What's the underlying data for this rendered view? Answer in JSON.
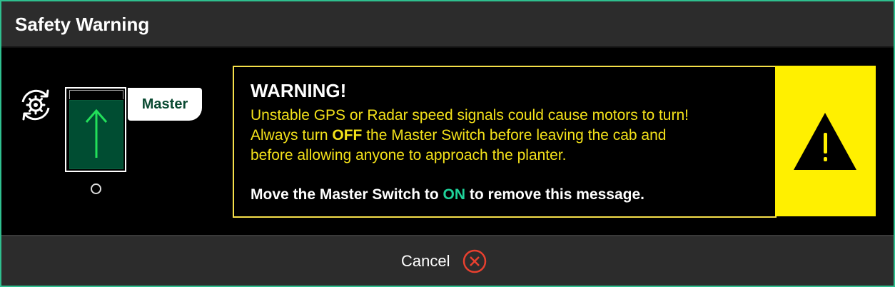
{
  "dialog": {
    "title": "Safety Warning"
  },
  "switch": {
    "label": "Master"
  },
  "warning": {
    "heading": "WARNING!",
    "line1": "Unstable GPS or Radar speed signals could cause motors to turn!",
    "line2_pre": "Always turn ",
    "line2_bold": "OFF",
    "line2_post": " the Master Switch before leaving the cab and",
    "line3": "before allowing anyone to approach the planter.",
    "remove_pre": "Move the Master Switch to ",
    "remove_on": "ON",
    "remove_post": " to remove this message."
  },
  "footer": {
    "cancel_label": "Cancel"
  },
  "colors": {
    "accent_border": "#2fbf8f",
    "warning_yellow": "#fff000",
    "on_green": "#1fd29a",
    "cancel_red": "#e8402f"
  }
}
